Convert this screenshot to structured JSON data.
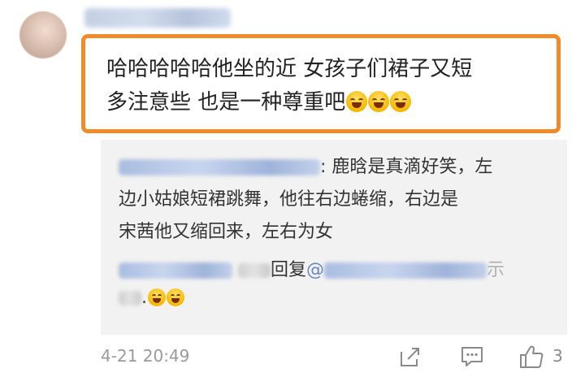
{
  "comment": {
    "lines": [
      "哈哈哈哈哈他坐的近 女孩子们裙子又短",
      "多注意些 也是一种尊重吧"
    ],
    "emojis": [
      "laughing-crying-emoji",
      "laughing-crying-emoji",
      "laughing-crying-emoji"
    ]
  },
  "reply": {
    "line1_text": ": 鹿晗是真滴好笑，左",
    "line2": "边小姑娘短裙跳舞，他往右边蜷缩，右边是",
    "line3": "宋茜他又缩回来，左右为女",
    "sub_reply_label": "回复",
    "sub_reply_at": "@",
    "sub_reply_tail": "示",
    "sub_reply_dot": "."
  },
  "meta": {
    "timestamp": "4-21 20:49",
    "like_count": "3"
  },
  "colors": {
    "highlight_border": "#f18b2a",
    "reply_bg": "#f2f2f2",
    "blurred_name": "#b3c4e4"
  },
  "icons": [
    "share-icon",
    "comment-icon",
    "like-icon"
  ]
}
